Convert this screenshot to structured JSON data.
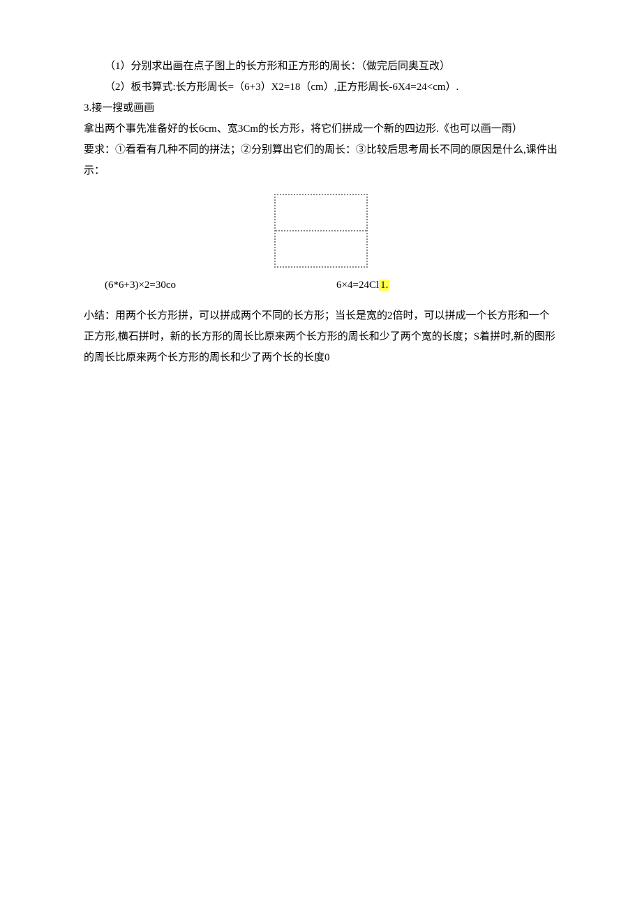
{
  "para1": "（1）分别求出画在点子图上的长方形和正方形的周长：（做完后同奥互改）",
  "para2": "（2）板书算式:长方形周长=（6+3）X2=18（cm）,正方形周长-6X4=24<cm）.",
  "para3": "3.接一搜或画画",
  "para4": "拿出两个事先准备好的长6cm、宽3Cm的长方形，将它们拼成一个新的四边形.《也可以画一雨）",
  "para5": "要求：①看看有几种不同的拼法；②分别算出它们的周长：③比较后思考周长不同的原因是什么,课件出示：",
  "exprLeft": "(6*6+3)×2=30co",
  "exprRightA": "6×4=24Cl",
  "exprRightB": "1.",
  "summary": "小结：用两个长方形拼，可以拼成两个不同的长方形；当长是宽的2倍时，可以拼成一个长方形和一个正方形,横石拼时，新的长方形的周长比原来两个长方形的周长和少了两个宽的长度；S着拼时,新的图形的周长比原来两个长方形的周长和少了两个长的长度0"
}
